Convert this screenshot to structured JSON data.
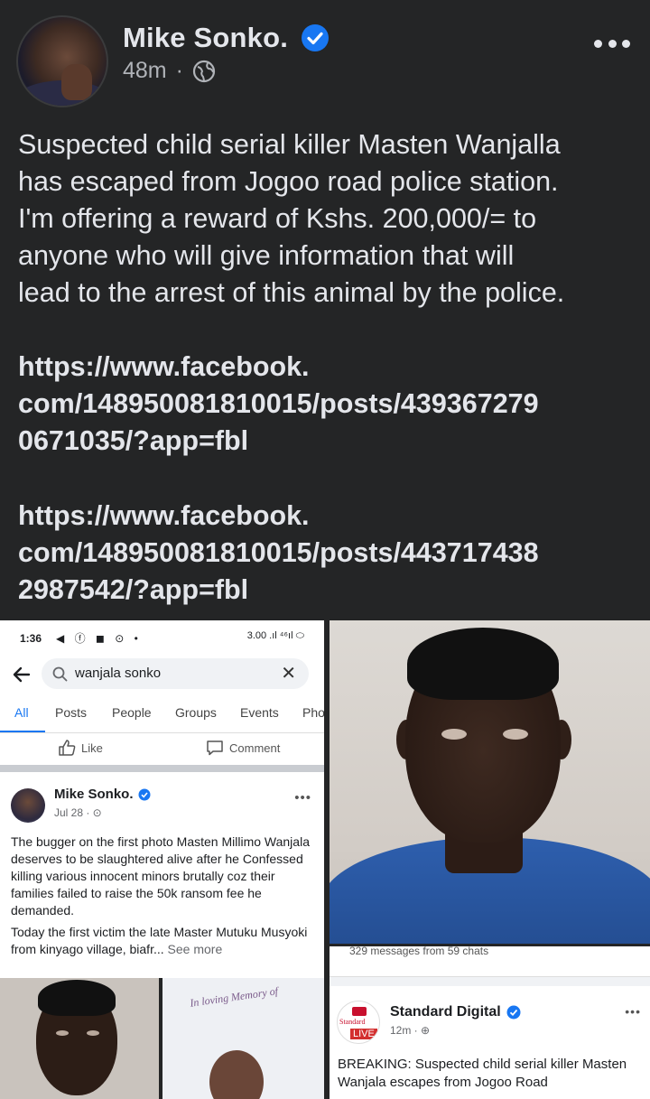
{
  "post": {
    "author": "Mike Sonko.",
    "time": "48m",
    "dot": "·",
    "body": [
      "Suspected child serial killer Masten Wanjalla",
      "has escaped from Jogoo road police station.",
      "I'm offering a reward of Kshs. 200,000/= to",
      "anyone who will give information that will",
      "lead to the arrest of this animal by the police."
    ],
    "link1": [
      "https://www.facebook.",
      "com/148950081810015/posts/439367279",
      "0671035/?app=fbl"
    ],
    "link2": [
      "https://www.facebook.",
      "com/148950081810015/posts/443717438",
      "2987542/?app=fbl"
    ]
  },
  "screenshot": {
    "status_time": "1:36",
    "status_icons": "◀ ⓕ ◼ ⊙ •",
    "status_right": "3.00 .ıl ⁴⁶ıl ⬭",
    "search_query": "wanjala sonko",
    "filters": [
      "All",
      "Posts",
      "People",
      "Groups",
      "Events",
      "Pho"
    ],
    "like_label": "Like",
    "comment_label": "Comment",
    "inner_author": "Mike Sonko.",
    "inner_meta": "Jul 28 · ⊙",
    "inner_more": "•••",
    "inner_text1": "The bugger on the first photo Masten Millimo Wanjala deserves to be slaughtered alive after he Confessed  killing various innocent minors brutally coz their families failed to raise the 50k ransom fee he demanded.",
    "inner_text2": "Today the first victim the late Master Mutuku Musyoki from kinyago village, biafr...",
    "see_more": "See more"
  },
  "standard": {
    "messages": "329 messages from 59 chats",
    "logo_word": "Standard",
    "live": "LIVE",
    "name": "Standard Digital",
    "meta": "12m · ⊕",
    "more": "•••",
    "text": "BREAKING: Suspected child serial killer Masten Wanjala escapes from Jogoo Road"
  },
  "memorial": {
    "text": "In loving Memory of"
  },
  "colors": {
    "background": "#242526",
    "text": "#e4e6eb",
    "secondary": "#b0b3b8",
    "verified": "#1877f2"
  }
}
